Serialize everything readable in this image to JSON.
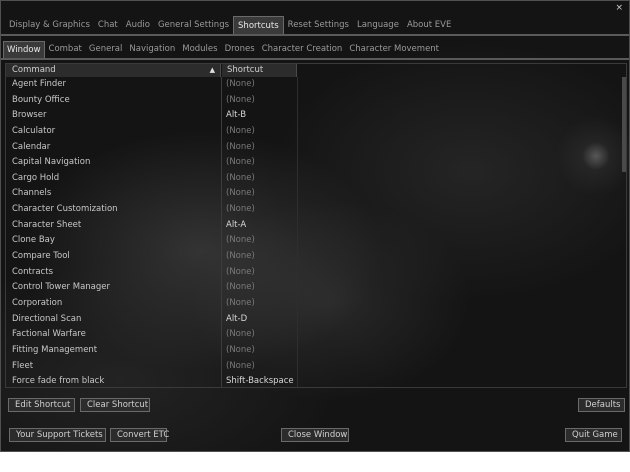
{
  "window": {
    "close_glyph": "×"
  },
  "main_tabs": [
    {
      "label": "Display & Graphics",
      "active": false
    },
    {
      "label": "Chat",
      "active": false
    },
    {
      "label": "Audio",
      "active": false
    },
    {
      "label": "General Settings",
      "active": false
    },
    {
      "label": "Shortcuts",
      "active": true
    },
    {
      "label": "Reset Settings",
      "active": false
    },
    {
      "label": "Language",
      "active": false
    },
    {
      "label": "About EVE",
      "active": false
    }
  ],
  "sub_tabs": [
    {
      "label": "Window",
      "active": true
    },
    {
      "label": "Combat",
      "active": false
    },
    {
      "label": "General",
      "active": false
    },
    {
      "label": "Navigation",
      "active": false
    },
    {
      "label": "Modules",
      "active": false
    },
    {
      "label": "Drones",
      "active": false
    },
    {
      "label": "Character Creation",
      "active": false
    },
    {
      "label": "Character Movement",
      "active": false
    }
  ],
  "table": {
    "columns": {
      "command": "Command",
      "shortcut": "Shortcut"
    },
    "sort_glyph": "▲",
    "rows": [
      {
        "command": "Agent Finder",
        "shortcut": "(None)"
      },
      {
        "command": "Bounty Office",
        "shortcut": "(None)"
      },
      {
        "command": "Browser",
        "shortcut": "Alt-B"
      },
      {
        "command": "Calculator",
        "shortcut": "(None)"
      },
      {
        "command": "Calendar",
        "shortcut": "(None)"
      },
      {
        "command": "Capital Navigation",
        "shortcut": "(None)"
      },
      {
        "command": "Cargo Hold",
        "shortcut": "(None)"
      },
      {
        "command": "Channels",
        "shortcut": "(None)"
      },
      {
        "command": "Character Customization",
        "shortcut": "(None)"
      },
      {
        "command": "Character Sheet",
        "shortcut": "Alt-A"
      },
      {
        "command": "Clone Bay",
        "shortcut": "(None)"
      },
      {
        "command": "Compare Tool",
        "shortcut": "(None)"
      },
      {
        "command": "Contracts",
        "shortcut": "(None)"
      },
      {
        "command": "Control Tower Manager",
        "shortcut": "(None)"
      },
      {
        "command": "Corporation",
        "shortcut": "(None)"
      },
      {
        "command": "Directional Scan",
        "shortcut": "Alt-D"
      },
      {
        "command": "Factional Warfare",
        "shortcut": "(None)"
      },
      {
        "command": "Fitting Management",
        "shortcut": "(None)"
      },
      {
        "command": "Fleet",
        "shortcut": "(None)"
      },
      {
        "command": "Force fade from black",
        "shortcut": "Shift-Backspace"
      }
    ]
  },
  "buttons": {
    "edit_shortcut": "Edit Shortcut",
    "clear_shortcut": "Clear Shortcut",
    "defaults": "Defaults",
    "support_tickets": "Your Support Tickets",
    "convert_etc": "Convert ETC",
    "close_window": "Close Window",
    "quit_game": "Quit Game"
  }
}
